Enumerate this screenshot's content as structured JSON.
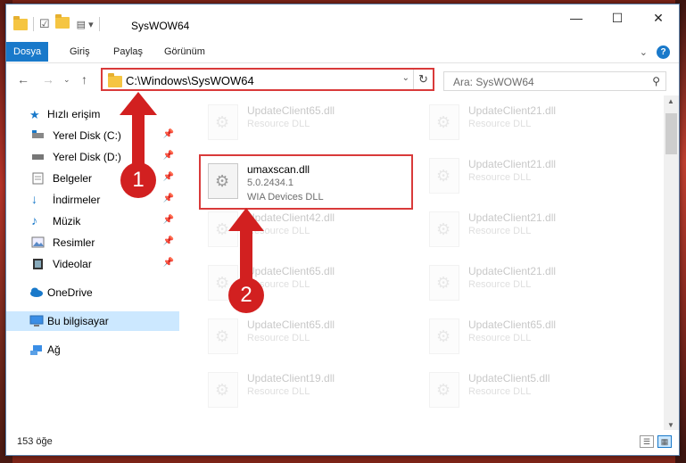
{
  "window": {
    "title": "SysWOW64"
  },
  "ribbon": {
    "tabs": [
      "Dosya",
      "Giriş",
      "Paylaş",
      "Görünüm"
    ]
  },
  "address": {
    "path": "C:\\Windows\\SysWOW64",
    "search_placeholder": "Ara: SysWOW64"
  },
  "sidebar": {
    "items": [
      {
        "label": "Hızlı erişim",
        "icon": "star-icon"
      },
      {
        "label": "Yerel Disk (C:)",
        "icon": "drive-icon"
      },
      {
        "label": "Yerel Disk (D:)",
        "icon": "drive-icon"
      },
      {
        "label": "Belgeler",
        "icon": "documents-icon"
      },
      {
        "label": "İndirmeler",
        "icon": "downloads-icon"
      },
      {
        "label": "Müzik",
        "icon": "music-icon"
      },
      {
        "label": "Resimler",
        "icon": "pictures-icon"
      },
      {
        "label": "Videolar",
        "icon": "videos-icon"
      },
      {
        "label": "OneDrive",
        "icon": "cloud-icon"
      },
      {
        "label": "Bu bilgisayar",
        "icon": "computer-icon"
      },
      {
        "label": "Ağ",
        "icon": "network-icon"
      }
    ]
  },
  "files": {
    "left": [
      {
        "name": "UpdateClient65.dll",
        "type": "Resource DLL"
      },
      {
        "name": "umaxscan.dll",
        "version": "5.0.2434.1",
        "type": "WIA Devices DLL"
      },
      {
        "name": "UpdateClient42.dll",
        "type": "Resource DLL"
      },
      {
        "name": "UpdateClient65.dll",
        "type": "Resource DLL"
      },
      {
        "name": "UpdateClient65.dll",
        "type": "Resource DLL"
      },
      {
        "name": "UpdateClient19.dll",
        "type": "Resource DLL"
      }
    ],
    "right": [
      {
        "name": "UpdateClient21.dll",
        "type": "Resource DLL"
      },
      {
        "name": "UpdateClient21.dll",
        "type": "Resource DLL"
      },
      {
        "name": "UpdateClient21.dll",
        "type": "Resource DLL"
      },
      {
        "name": "UpdateClient21.dll",
        "type": "Resource DLL"
      },
      {
        "name": "UpdateClient65.dll",
        "type": "Resource DLL"
      },
      {
        "name": "UpdateClient5.dll",
        "type": "Resource DLL"
      }
    ]
  },
  "status": {
    "count": "153 öğe"
  },
  "annotations": {
    "step1": "1",
    "step2": "2"
  },
  "colors": {
    "accent": "#1979ca",
    "highlight": "#d93a3a",
    "annotation": "#d22020"
  }
}
